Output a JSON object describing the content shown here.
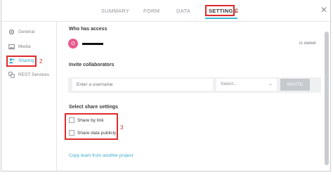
{
  "tabs": [
    {
      "label": "SUMMARY"
    },
    {
      "label": "FORM"
    },
    {
      "label": "DATA"
    },
    {
      "label": "SETTINGS",
      "active": true
    }
  ],
  "annotations": {
    "n1": "1",
    "n2": "2",
    "n3": "3"
  },
  "sidebar": {
    "items": [
      {
        "label": "General",
        "icon": "gear-icon"
      },
      {
        "label": "Media",
        "icon": "image-icon"
      },
      {
        "label": "Sharing",
        "icon": "add-user-icon",
        "active": true
      },
      {
        "label": "REST Services",
        "icon": "rest-icon"
      }
    ]
  },
  "access": {
    "title": "Who has access",
    "avatar_letter": "O",
    "owner_label": "is owner"
  },
  "invite": {
    "title": "Invite collaborators",
    "username_placeholder": "Enter a username",
    "select_value": "Select...",
    "button_label": "INVITE"
  },
  "share": {
    "title": "Select share settings",
    "options": [
      {
        "label": "Share by link",
        "checked": false
      },
      {
        "label": "Share data publicly",
        "checked": false
      }
    ]
  },
  "copy_team_label": "Copy team from another project",
  "colors": {
    "accent": "#3fb8d9",
    "highlight": "#e02a2a",
    "avatar": "#ea5a8e"
  }
}
